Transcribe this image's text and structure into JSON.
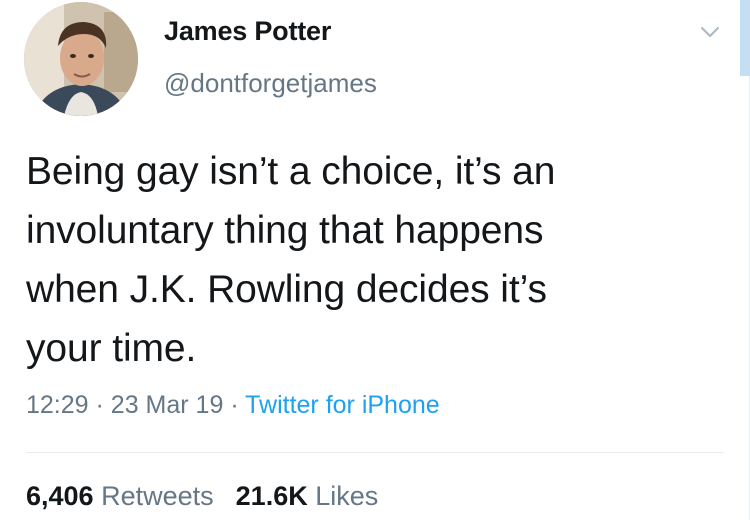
{
  "user": {
    "display_name": "James Potter",
    "handle": "@dontforgetjames"
  },
  "tweet": {
    "lines": [
      "Being gay isn’t a choice, it’s an",
      "involuntary thing that happens",
      "when J.K. Rowling decides it’s",
      "your time."
    ],
    "time": "12:29",
    "date": "23 Mar 19",
    "separator": "·",
    "source": "Twitter for iPhone"
  },
  "stats": {
    "retweets_count": "6,406",
    "retweets_label": "Retweets",
    "likes_count": "21.6K",
    "likes_label": "Likes"
  },
  "colors": {
    "text": "#14171a",
    "secondary": "#657786",
    "link": "#1da1f2",
    "divider": "#e6ecf0"
  },
  "icons": {
    "menu": "chevron-down-icon",
    "avatar": "profile-photo"
  }
}
